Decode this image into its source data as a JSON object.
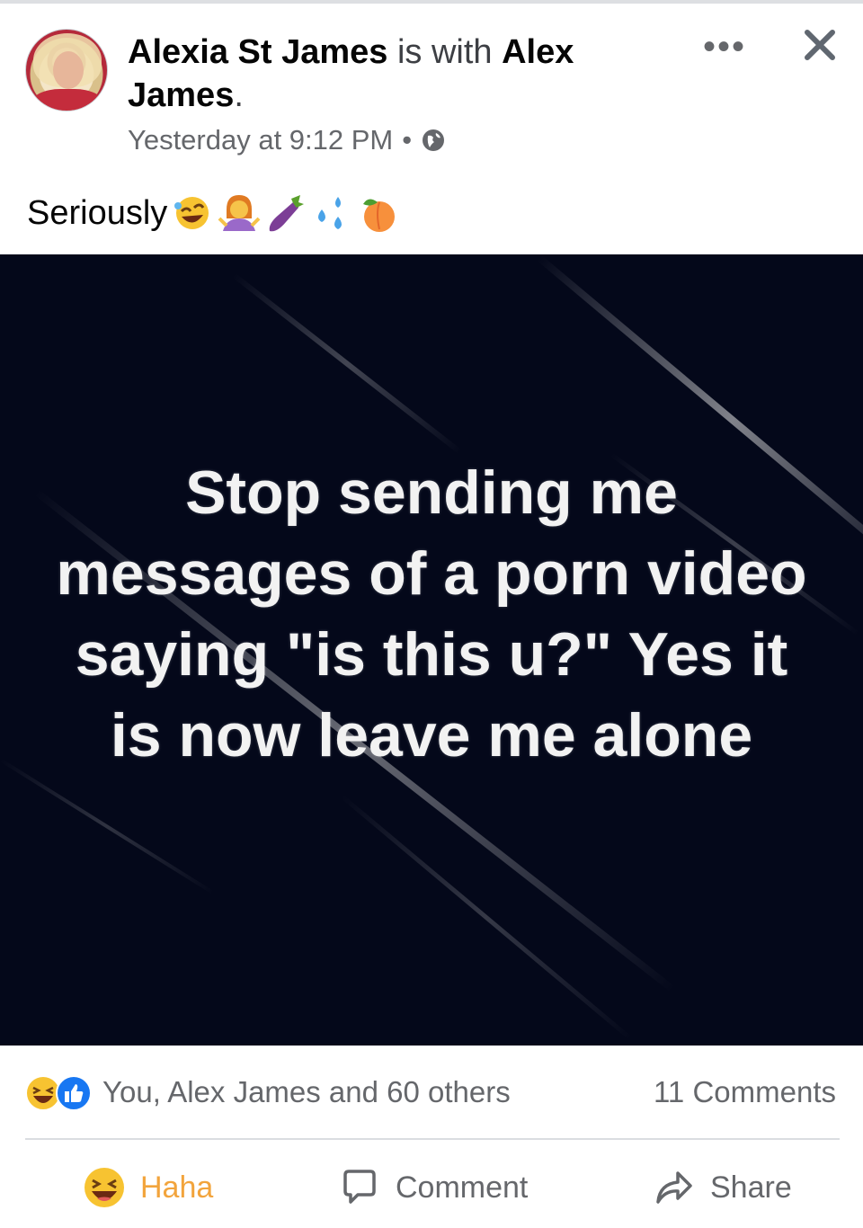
{
  "post": {
    "author": "Alexia St James",
    "with_word": "is with",
    "tagged": "Alex James",
    "period": ".",
    "timestamp": "Yesterday at 9:12 PM",
    "separator": "•",
    "privacy_icon": "globe-icon",
    "more_label": "•••",
    "caption": "Seriously",
    "caption_emojis": [
      "rolling-laughing-emoji",
      "woman-shrugging-emoji",
      "eggplant-emoji",
      "sweat-droplets-emoji",
      "peach-emoji"
    ]
  },
  "image": {
    "text": "Stop sending me messages of a porn video saying \"is this u?\" Yes it is now leave me alone",
    "background": "#04081a"
  },
  "footer": {
    "reaction_icons": [
      "haha-reaction-icon",
      "like-reaction-icon"
    ],
    "reactions_text": "You, Alex James and 60 others",
    "comments_count": "11 Comments",
    "actions": {
      "haha": "Haha",
      "comment": "Comment",
      "share": "Share"
    }
  },
  "colors": {
    "text_primary": "#050505",
    "text_secondary": "#65676b",
    "haha_active": "#f2a43c",
    "like_blue": "#1877f2"
  }
}
